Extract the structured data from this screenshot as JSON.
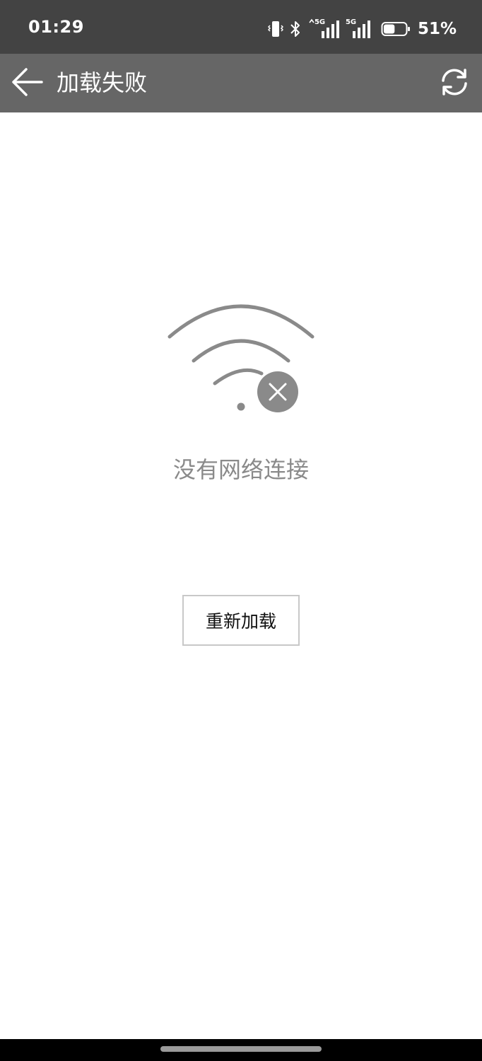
{
  "status_bar": {
    "time": "01:29",
    "battery_percent": "51%",
    "battery_level": 0.51,
    "signal_1_label": "5G",
    "signal_2_label": "5G",
    "icons": [
      "vibrate-icon",
      "bluetooth-icon",
      "signal-5g-icon",
      "signal-5g-icon",
      "battery-icon"
    ]
  },
  "header": {
    "title": "加载失败",
    "back_icon": "arrow-left-icon",
    "refresh_icon": "refresh-icon"
  },
  "main": {
    "graphic_icon": "wifi-off-icon",
    "error_message": "没有网络连接",
    "reload_button_label": "重新加载"
  },
  "colors": {
    "status_bar_bg": "#434343",
    "title_bar_bg": "#666666",
    "graphic_gray": "#8a8a8a",
    "background": "#ffffff"
  }
}
